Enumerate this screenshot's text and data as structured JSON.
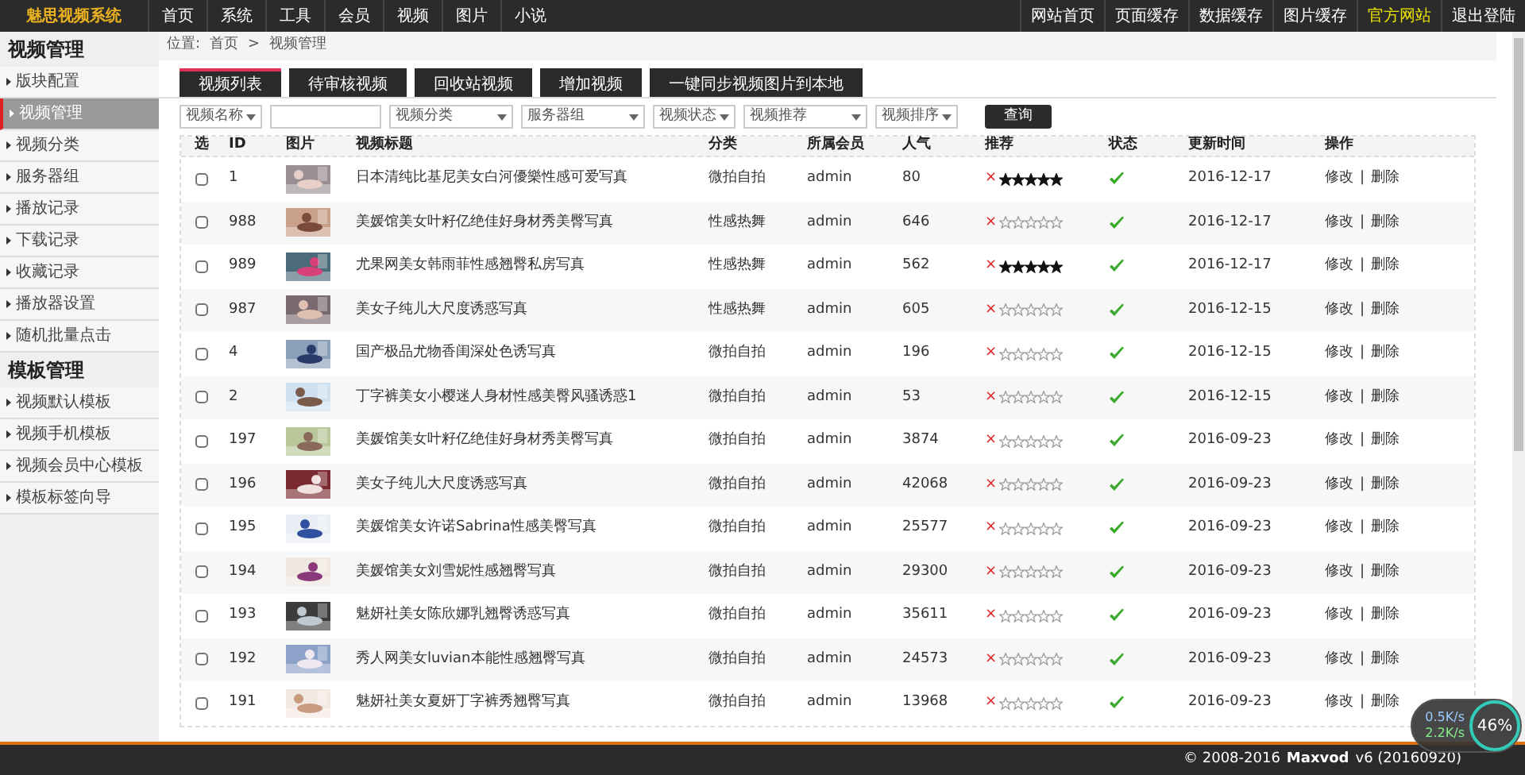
{
  "top_bar": {
    "logo": "魅思视频系统",
    "nav": [
      {
        "label": "首页"
      },
      {
        "label": "系统"
      },
      {
        "label": "工具"
      },
      {
        "label": "会员"
      },
      {
        "label": "视频"
      },
      {
        "label": "图片"
      },
      {
        "label": "小说"
      }
    ],
    "right_links": [
      {
        "label": "网站首页",
        "highlight": false
      },
      {
        "label": "页面缓存",
        "highlight": false
      },
      {
        "label": "数据缓存",
        "highlight": false
      },
      {
        "label": "图片缓存",
        "highlight": false
      },
      {
        "label": "官方网站",
        "highlight": true
      },
      {
        "label": "退出登陆",
        "highlight": false
      }
    ]
  },
  "sidebar": {
    "sections": [
      {
        "title": "视频管理",
        "items": [
          {
            "label": "版块配置",
            "selected": false
          },
          {
            "label": "视频管理",
            "selected": true
          },
          {
            "label": "视频分类",
            "selected": false
          },
          {
            "label": "服务器组",
            "selected": false
          },
          {
            "label": "播放记录",
            "selected": false
          },
          {
            "label": "下载记录",
            "selected": false
          },
          {
            "label": "收藏记录",
            "selected": false
          },
          {
            "label": "播放器设置",
            "selected": false
          },
          {
            "label": "随机批量点击",
            "selected": false
          }
        ]
      },
      {
        "title": "模板管理",
        "items": [
          {
            "label": "视频默认模板",
            "selected": false
          },
          {
            "label": "视频手机模板",
            "selected": false
          },
          {
            "label": "视频会员中心模板",
            "selected": false
          },
          {
            "label": "模板标签向导",
            "selected": false
          }
        ]
      }
    ]
  },
  "breadcrumb": {
    "label": "位置:",
    "items": [
      "首页",
      "视频管理"
    ],
    "separator": ">"
  },
  "tabs": [
    {
      "label": "视频列表",
      "selected": true
    },
    {
      "label": "待审核视频",
      "selected": false
    },
    {
      "label": "回收站视频",
      "selected": false
    },
    {
      "label": "增加视频",
      "selected": false
    },
    {
      "label": "一键同步视频图片到本地",
      "selected": false
    }
  ],
  "filters": [
    {
      "kind": "dropdown",
      "label": "视频名称"
    },
    {
      "kind": "input"
    },
    {
      "kind": "select",
      "label": "视频分类"
    },
    {
      "kind": "select",
      "label": "服务器组"
    },
    {
      "kind": "dropdown",
      "label": "视频状态"
    },
    {
      "kind": "select",
      "label": "视频推荐"
    },
    {
      "kind": "dropdown",
      "label": "视频排序"
    },
    {
      "kind": "button",
      "label": "查询"
    }
  ],
  "table": {
    "columns": [
      "选",
      "ID",
      "图片",
      "视频标题",
      "分类",
      "所属会员",
      "人气",
      "推荐",
      "状态",
      "更新时间",
      "操作"
    ],
    "rows": [
      {
        "checked": false,
        "id": "1",
        "title": "日本清纯比基尼美女白河優樂性感可爱写真",
        "category": "微拍自拍",
        "member": "admin",
        "popularity": "80",
        "clear_mark": "×",
        "stars": 5,
        "status_ok": true,
        "updated": "2016-12-17",
        "actions": [
          "修改",
          "|",
          "删除"
        ]
      },
      {
        "checked": false,
        "id": "988",
        "title": "美媛馆美女叶籽亿绝佳好身材秀美臀写真",
        "category": "性感热舞",
        "member": "admin",
        "popularity": "646",
        "clear_mark": "×",
        "stars": 0,
        "status_ok": true,
        "updated": "2016-12-17",
        "actions": [
          "修改",
          "|",
          "删除"
        ]
      },
      {
        "checked": false,
        "id": "989",
        "title": "尤果网美女韩雨菲性感翘臀私房写真",
        "category": "性感热舞",
        "member": "admin",
        "popularity": "562",
        "clear_mark": "×",
        "stars": 5,
        "status_ok": true,
        "updated": "2016-12-17",
        "actions": [
          "修改",
          "|",
          "删除"
        ]
      },
      {
        "checked": false,
        "id": "987",
        "title": "美女子纯儿大尺度诱惑写真",
        "category": "性感热舞",
        "member": "admin",
        "popularity": "605",
        "clear_mark": "×",
        "stars": 0,
        "status_ok": true,
        "updated": "2016-12-15",
        "actions": [
          "修改",
          "|",
          "删除"
        ]
      },
      {
        "checked": false,
        "id": "4",
        "title": "国产极品尤物香闺深处色诱写真",
        "category": "微拍自拍",
        "member": "admin",
        "popularity": "196",
        "clear_mark": "×",
        "stars": 0,
        "status_ok": true,
        "updated": "2016-12-15",
        "actions": [
          "修改",
          "|",
          "删除"
        ]
      },
      {
        "checked": false,
        "id": "2",
        "title": "丁字裤美女小樱迷人身材性感美臀风骚诱惑1",
        "category": "微拍自拍",
        "member": "admin",
        "popularity": "53",
        "clear_mark": "×",
        "stars": 0,
        "status_ok": true,
        "updated": "2016-12-15",
        "actions": [
          "修改",
          "|",
          "删除"
        ]
      },
      {
        "checked": false,
        "id": "197",
        "title": "美媛馆美女叶籽亿绝佳好身材秀美臀写真",
        "category": "微拍自拍",
        "member": "admin",
        "popularity": "3874",
        "clear_mark": "×",
        "stars": 0,
        "status_ok": true,
        "updated": "2016-09-23",
        "actions": [
          "修改",
          "|",
          "删除"
        ]
      },
      {
        "checked": false,
        "id": "196",
        "title": "美女子纯儿大尺度诱惑写真",
        "category": "微拍自拍",
        "member": "admin",
        "popularity": "42068",
        "clear_mark": "×",
        "stars": 0,
        "status_ok": true,
        "updated": "2016-09-23",
        "actions": [
          "修改",
          "|",
          "删除"
        ]
      },
      {
        "checked": false,
        "id": "195",
        "title": "美媛馆美女许诺Sabrina性感美臀写真",
        "category": "微拍自拍",
        "member": "admin",
        "popularity": "25577",
        "clear_mark": "×",
        "stars": 0,
        "status_ok": true,
        "updated": "2016-09-23",
        "actions": [
          "修改",
          "|",
          "删除"
        ]
      },
      {
        "checked": false,
        "id": "194",
        "title": "美媛馆美女刘雪妮性感翘臀写真",
        "category": "微拍自拍",
        "member": "admin",
        "popularity": "29300",
        "clear_mark": "×",
        "stars": 0,
        "status_ok": true,
        "updated": "2016-09-23",
        "actions": [
          "修改",
          "|",
          "删除"
        ]
      },
      {
        "checked": false,
        "id": "193",
        "title": "魅妍社美女陈欣娜乳翘臀诱惑写真",
        "category": "微拍自拍",
        "member": "admin",
        "popularity": "35611",
        "clear_mark": "×",
        "stars": 0,
        "status_ok": true,
        "updated": "2016-09-23",
        "actions": [
          "修改",
          "|",
          "删除"
        ]
      },
      {
        "checked": false,
        "id": "192",
        "title": "秀人网美女luvian本能性感翘臀写真",
        "category": "微拍自拍",
        "member": "admin",
        "popularity": "24573",
        "clear_mark": "×",
        "stars": 0,
        "status_ok": true,
        "updated": "2016-09-23",
        "actions": [
          "修改",
          "|",
          "删除"
        ]
      },
      {
        "checked": false,
        "id": "191",
        "title": "魅妍社美女夏妍丁字裤秀翘臀写真",
        "category": "微拍自拍",
        "member": "admin",
        "popularity": "13968",
        "clear_mark": "×",
        "stars": 0,
        "status_ok": true,
        "updated": "2016-09-23",
        "actions": [
          "修改",
          "|",
          "删除"
        ]
      }
    ]
  },
  "footer": {
    "copyright": "© 2008-2016",
    "product": "Maxvod",
    "version": "v6 (20160920)"
  },
  "speed_widget": {
    "upload": "0.5K/s",
    "download": "2.2K/s",
    "percent": "46%"
  }
}
